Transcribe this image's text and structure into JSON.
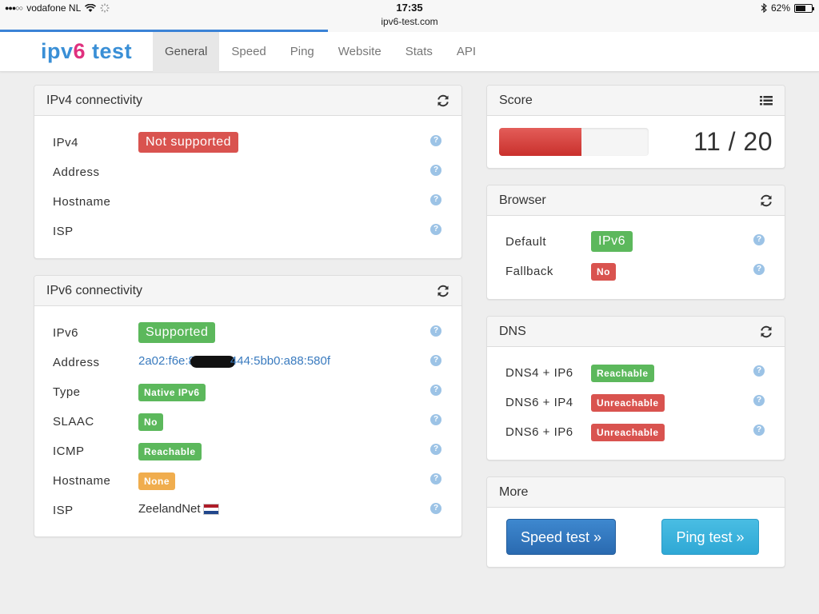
{
  "status_bar": {
    "carrier": "vodafone NL",
    "time": "17:35",
    "url": "ipv6-test.com",
    "battery": "62%",
    "battery_level": 0.62
  },
  "logo": {
    "part1": "ipv",
    "part2": "6",
    "part3": " test"
  },
  "nav": {
    "tabs": [
      "General",
      "Speed",
      "Ping",
      "Website",
      "Stats",
      "API"
    ],
    "active": "General"
  },
  "help_glyph": "?",
  "ipv4": {
    "title": "IPv4 connectivity",
    "icon": "refresh-icon",
    "rows": {
      "ipv4": {
        "label": "IPv4",
        "value": "Not supported",
        "color": "#d9534f"
      },
      "address": {
        "label": "Address"
      },
      "hostname": {
        "label": "Hostname"
      },
      "isp": {
        "label": "ISP"
      }
    }
  },
  "ipv6": {
    "title": "IPv6 connectivity",
    "icon": "refresh-icon",
    "rows": {
      "ipv6": {
        "label": "IPv6",
        "value": "Supported",
        "color": "#5cb85c"
      },
      "address": {
        "label": "Address",
        "value_start": "2a02:f6e:8",
        "value_end": "444:5bb0:a88:580f"
      },
      "type": {
        "label": "Type",
        "value": "Native IPv6"
      },
      "slaac": {
        "label": "SLAAC",
        "value": "No"
      },
      "icmp": {
        "label": "ICMP",
        "value": "Reachable"
      },
      "hostname": {
        "label": "Hostname",
        "value": "None",
        "color": "#f0ad4e"
      },
      "isp": {
        "label": "ISP",
        "value": "ZeelandNet",
        "flag": "netherlands-flag-icon"
      }
    }
  },
  "score": {
    "title": "Score",
    "icon": "list-icon",
    "value": "11 / 20",
    "fraction": 0.55,
    "bar_color": "#d9534f"
  },
  "browser": {
    "title": "Browser",
    "icon": "refresh-icon",
    "rows": {
      "default": {
        "label": "Default",
        "value": "IPv6",
        "color": "#5cb85c"
      },
      "fallback": {
        "label": "Fallback",
        "value": "No",
        "color": "#d9534f"
      }
    }
  },
  "dns": {
    "title": "DNS",
    "icon": "refresh-icon",
    "rows": {
      "dns4_ip6": {
        "label": "DNS4 + IP6",
        "value": "Reachable",
        "color": "#5cb85c"
      },
      "dns6_ip4": {
        "label": "DNS6 + IP4",
        "value": "Unreachable",
        "color": "#d9534f"
      },
      "dns6_ip6": {
        "label": "DNS6 + IP6",
        "value": "Unreachable",
        "color": "#d9534f"
      }
    }
  },
  "more": {
    "title": "More",
    "speed_button": "Speed test »",
    "ping_button": "Ping test »"
  }
}
